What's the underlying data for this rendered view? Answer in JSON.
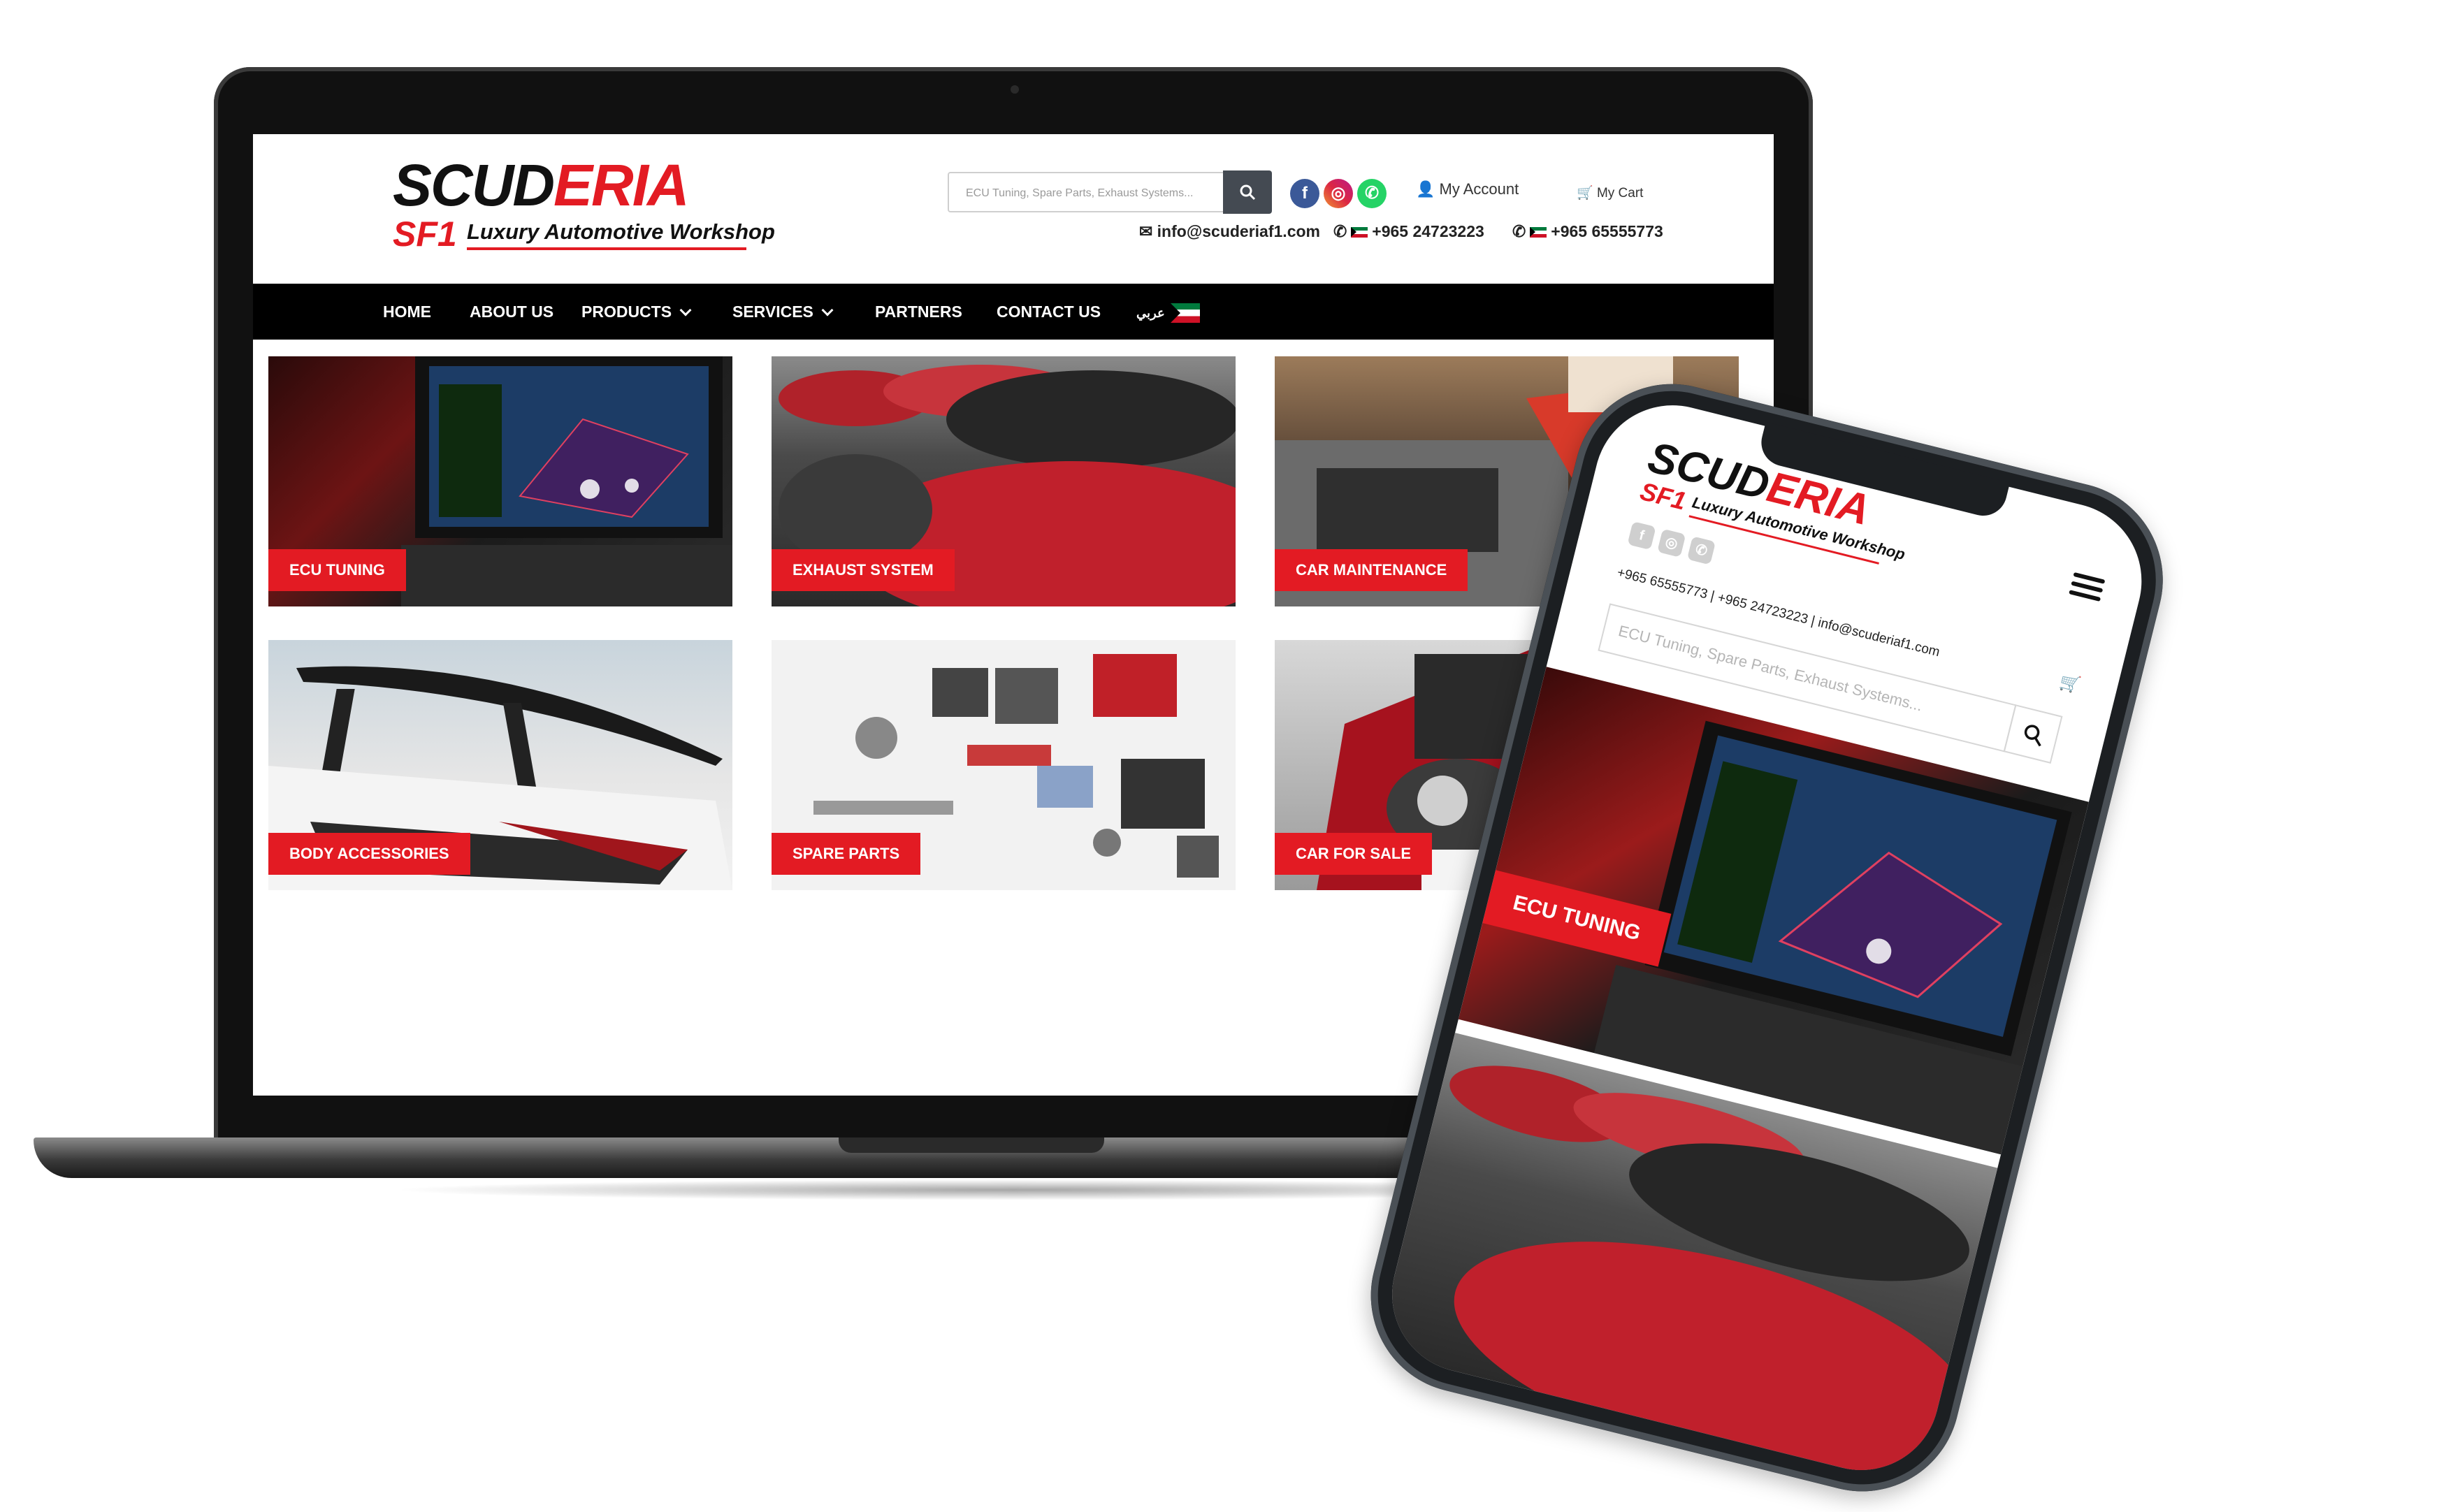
{
  "brand": {
    "logo_main_black": "SCUD",
    "logo_main_red": "ERIA",
    "logo_sub": "SF1",
    "logo_tagline": "Luxury Automotive Workshop"
  },
  "header": {
    "search_placeholder": "ECU Tuning, Spare Parts, Exhaust Systems...",
    "social": {
      "facebook": "f",
      "instagram": "◎",
      "whatsapp": "✆"
    },
    "account_label": "My Account",
    "cart_label": "My Cart",
    "email": "info@scuderiaf1.com",
    "phone1": "+965 24723223",
    "phone2": "+965 65555773"
  },
  "nav": {
    "items": [
      "HOME",
      "ABOUT US",
      "PRODUCTS",
      "SERVICES",
      "PARTNERS",
      "CONTACT US"
    ],
    "language": "عربي"
  },
  "tiles": [
    {
      "label": "ECU TUNING"
    },
    {
      "label": "EXHAUST SYSTEM"
    },
    {
      "label": "CAR MAINTENANCE"
    },
    {
      "label": "BODY ACCESSORIES"
    },
    {
      "label": "SPARE PARTS"
    },
    {
      "label": "CAR FOR SALE"
    }
  ],
  "mobile": {
    "contacts": "+965 65555773  |  +965 24723223  |  info@scuderiaf1.com",
    "search_placeholder": "ECU Tuning, Spare Parts, Exhaust Systems...",
    "first_tile_label": "ECU TUNING"
  },
  "colors": {
    "accent": "#e31b23",
    "nav_bg": "#000000",
    "search_btn": "#444a52"
  }
}
